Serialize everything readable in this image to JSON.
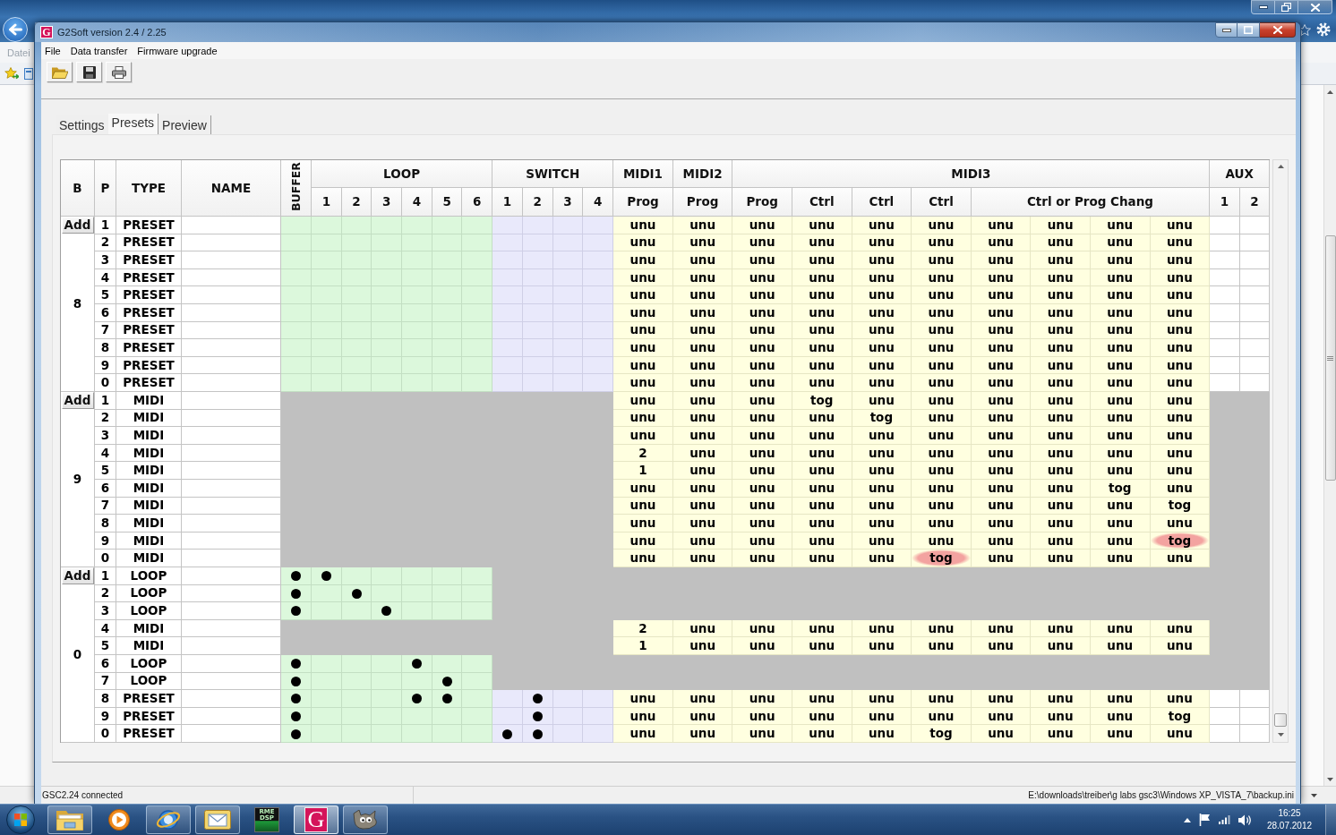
{
  "background_window": {
    "menu": [
      "Datei"
    ]
  },
  "window": {
    "logo": "G",
    "title": "G2Soft version 2.4 / 2.25"
  },
  "menu": [
    "File",
    "Data transfer",
    "Firmware upgrade"
  ],
  "tabs": [
    {
      "label": "Settings",
      "selected": false
    },
    {
      "label": "Presets",
      "selected": true
    },
    {
      "label": "Preview",
      "selected": false
    }
  ],
  "table": {
    "columns": [
      {
        "kind": "single",
        "label": "B"
      },
      {
        "kind": "single",
        "label": "P"
      },
      {
        "kind": "single",
        "label": "TYPE"
      },
      {
        "kind": "single",
        "label": "NAME"
      },
      {
        "kind": "vertical",
        "label": "BUFFER"
      },
      {
        "kind": "group",
        "label": "LOOP",
        "subs": [
          {
            "kind": "single",
            "label": "1"
          },
          {
            "kind": "single",
            "label": "2"
          },
          {
            "kind": "single",
            "label": "3"
          },
          {
            "kind": "single",
            "label": "4"
          },
          {
            "kind": "single",
            "label": "5"
          },
          {
            "kind": "single",
            "label": "6"
          }
        ]
      },
      {
        "kind": "group",
        "label": "SWITCH",
        "subs": [
          {
            "kind": "single",
            "label": "1"
          },
          {
            "kind": "single",
            "label": "2"
          },
          {
            "kind": "single",
            "label": "3"
          },
          {
            "kind": "single",
            "label": "4"
          }
        ]
      },
      {
        "kind": "group",
        "label": "MIDI1",
        "subs": [
          {
            "kind": "single",
            "label": "Prog"
          }
        ]
      },
      {
        "kind": "group",
        "label": "MIDI2",
        "subs": [
          {
            "kind": "single",
            "label": "Prog"
          }
        ]
      },
      {
        "kind": "group",
        "label": "MIDI3",
        "subs": [
          {
            "kind": "single",
            "label": "Prog"
          },
          {
            "kind": "single",
            "label": "Ctrl"
          },
          {
            "kind": "single",
            "label": "Ctrl"
          },
          {
            "kind": "single",
            "label": "Ctrl"
          },
          {
            "kind": "wide",
            "label": "Ctrl or Prog Chang"
          }
        ]
      },
      {
        "kind": "group",
        "label": "AUX",
        "subs": [
          {
            "kind": "single",
            "label": "1"
          },
          {
            "kind": "single",
            "label": "2"
          }
        ]
      }
    ],
    "banks": [
      {
        "add_button": "Add",
        "label": "8",
        "rows": [
          {
            "kind": "preset",
            "p": "1",
            "type": "PRESET",
            "buffer": false,
            "loops": [
              false,
              false,
              false,
              false,
              false,
              false
            ],
            "switches": [
              false,
              false,
              false,
              false
            ],
            "midi": [
              "unu",
              "unu",
              "unu",
              "unu",
              "unu",
              "unu",
              "unu",
              "unu",
              "unu",
              "unu"
            ],
            "circled": [
              false,
              false,
              false,
              false,
              false,
              false,
              false,
              false,
              false,
              false
            ]
          },
          {
            "kind": "preset",
            "p": "2",
            "type": "PRESET",
            "buffer": false,
            "loops": [
              false,
              false,
              false,
              false,
              false,
              false
            ],
            "switches": [
              false,
              false,
              false,
              false
            ],
            "midi": [
              "unu",
              "unu",
              "unu",
              "unu",
              "unu",
              "unu",
              "unu",
              "unu",
              "unu",
              "unu"
            ],
            "circled": [
              false,
              false,
              false,
              false,
              false,
              false,
              false,
              false,
              false,
              false
            ]
          },
          {
            "kind": "preset",
            "p": "3",
            "type": "PRESET",
            "buffer": false,
            "loops": [
              false,
              false,
              false,
              false,
              false,
              false
            ],
            "switches": [
              false,
              false,
              false,
              false
            ],
            "midi": [
              "unu",
              "unu",
              "unu",
              "unu",
              "unu",
              "unu",
              "unu",
              "unu",
              "unu",
              "unu"
            ],
            "circled": [
              false,
              false,
              false,
              false,
              false,
              false,
              false,
              false,
              false,
              false
            ]
          },
          {
            "kind": "preset",
            "p": "4",
            "type": "PRESET",
            "buffer": false,
            "loops": [
              false,
              false,
              false,
              false,
              false,
              false
            ],
            "switches": [
              false,
              false,
              false,
              false
            ],
            "midi": [
              "unu",
              "unu",
              "unu",
              "unu",
              "unu",
              "unu",
              "unu",
              "unu",
              "unu",
              "unu"
            ],
            "circled": [
              false,
              false,
              false,
              false,
              false,
              false,
              false,
              false,
              false,
              false
            ]
          },
          {
            "kind": "preset",
            "p": "5",
            "type": "PRESET",
            "buffer": false,
            "loops": [
              false,
              false,
              false,
              false,
              false,
              false
            ],
            "switches": [
              false,
              false,
              false,
              false
            ],
            "midi": [
              "unu",
              "unu",
              "unu",
              "unu",
              "unu",
              "unu",
              "unu",
              "unu",
              "unu",
              "unu"
            ],
            "circled": [
              false,
              false,
              false,
              false,
              false,
              false,
              false,
              false,
              false,
              false
            ]
          },
          {
            "kind": "preset",
            "p": "6",
            "type": "PRESET",
            "buffer": false,
            "loops": [
              false,
              false,
              false,
              false,
              false,
              false
            ],
            "switches": [
              false,
              false,
              false,
              false
            ],
            "midi": [
              "unu",
              "unu",
              "unu",
              "unu",
              "unu",
              "unu",
              "unu",
              "unu",
              "unu",
              "unu"
            ],
            "circled": [
              false,
              false,
              false,
              false,
              false,
              false,
              false,
              false,
              false,
              false
            ]
          },
          {
            "kind": "preset",
            "p": "7",
            "type": "PRESET",
            "buffer": false,
            "loops": [
              false,
              false,
              false,
              false,
              false,
              false
            ],
            "switches": [
              false,
              false,
              false,
              false
            ],
            "midi": [
              "unu",
              "unu",
              "unu",
              "unu",
              "unu",
              "unu",
              "unu",
              "unu",
              "unu",
              "unu"
            ],
            "circled": [
              false,
              false,
              false,
              false,
              false,
              false,
              false,
              false,
              false,
              false
            ]
          },
          {
            "kind": "preset",
            "p": "8",
            "type": "PRESET",
            "buffer": false,
            "loops": [
              false,
              false,
              false,
              false,
              false,
              false
            ],
            "switches": [
              false,
              false,
              false,
              false
            ],
            "midi": [
              "unu",
              "unu",
              "unu",
              "unu",
              "unu",
              "unu",
              "unu",
              "unu",
              "unu",
              "unu"
            ],
            "circled": [
              false,
              false,
              false,
              false,
              false,
              false,
              false,
              false,
              false,
              false
            ]
          },
          {
            "kind": "preset",
            "p": "9",
            "type": "PRESET",
            "buffer": false,
            "loops": [
              false,
              false,
              false,
              false,
              false,
              false
            ],
            "switches": [
              false,
              false,
              false,
              false
            ],
            "midi": [
              "unu",
              "unu",
              "unu",
              "unu",
              "unu",
              "unu",
              "unu",
              "unu",
              "unu",
              "unu"
            ],
            "circled": [
              false,
              false,
              false,
              false,
              false,
              false,
              false,
              false,
              false,
              false
            ]
          },
          {
            "kind": "preset",
            "p": "0",
            "type": "PRESET",
            "buffer": false,
            "loops": [
              false,
              false,
              false,
              false,
              false,
              false
            ],
            "switches": [
              false,
              false,
              false,
              false
            ],
            "midi": [
              "unu",
              "unu",
              "unu",
              "unu",
              "unu",
              "unu",
              "unu",
              "unu",
              "unu",
              "unu"
            ],
            "circled": [
              false,
              false,
              false,
              false,
              false,
              false,
              false,
              false,
              false,
              false
            ]
          }
        ]
      },
      {
        "add_button": "Add",
        "label": "9",
        "rows": [
          {
            "kind": "midi",
            "p": "1",
            "type": "MIDI",
            "midi": [
              "unu",
              "unu",
              "unu",
              "tog",
              "unu",
              "unu",
              "unu",
              "unu",
              "unu",
              "unu"
            ],
            "circled": [
              false,
              false,
              false,
              false,
              false,
              false,
              false,
              false,
              false,
              false
            ]
          },
          {
            "kind": "midi",
            "p": "2",
            "type": "MIDI",
            "midi": [
              "unu",
              "unu",
              "unu",
              "unu",
              "tog",
              "unu",
              "unu",
              "unu",
              "unu",
              "unu"
            ],
            "circled": [
              false,
              false,
              false,
              false,
              false,
              false,
              false,
              false,
              false,
              false
            ]
          },
          {
            "kind": "midi",
            "p": "3",
            "type": "MIDI",
            "midi": [
              "unu",
              "unu",
              "unu",
              "unu",
              "unu",
              "unu",
              "unu",
              "unu",
              "unu",
              "unu"
            ],
            "circled": [
              false,
              false,
              false,
              false,
              false,
              false,
              false,
              false,
              false,
              false
            ]
          },
          {
            "kind": "midi",
            "p": "4",
            "type": "MIDI",
            "midi": [
              "2",
              "unu",
              "unu",
              "unu",
              "unu",
              "unu",
              "unu",
              "unu",
              "unu",
              "unu"
            ],
            "circled": [
              false,
              false,
              false,
              false,
              false,
              false,
              false,
              false,
              false,
              false
            ]
          },
          {
            "kind": "midi",
            "p": "5",
            "type": "MIDI",
            "midi": [
              "1",
              "unu",
              "unu",
              "unu",
              "unu",
              "unu",
              "unu",
              "unu",
              "unu",
              "unu"
            ],
            "circled": [
              false,
              false,
              false,
              false,
              false,
              false,
              false,
              false,
              false,
              false
            ]
          },
          {
            "kind": "midi",
            "p": "6",
            "type": "MIDI",
            "midi": [
              "unu",
              "unu",
              "unu",
              "unu",
              "unu",
              "unu",
              "unu",
              "unu",
              "tog",
              "unu"
            ],
            "circled": [
              false,
              false,
              false,
              false,
              false,
              false,
              false,
              false,
              false,
              false
            ]
          },
          {
            "kind": "midi",
            "p": "7",
            "type": "MIDI",
            "midi": [
              "unu",
              "unu",
              "unu",
              "unu",
              "unu",
              "unu",
              "unu",
              "unu",
              "unu",
              "tog"
            ],
            "circled": [
              false,
              false,
              false,
              false,
              false,
              false,
              false,
              false,
              false,
              false
            ]
          },
          {
            "kind": "midi",
            "p": "8",
            "type": "MIDI",
            "midi": [
              "unu",
              "unu",
              "unu",
              "unu",
              "unu",
              "unu",
              "unu",
              "unu",
              "unu",
              "unu"
            ],
            "circled": [
              false,
              false,
              false,
              false,
              false,
              false,
              false,
              false,
              false,
              false
            ]
          },
          {
            "kind": "midi",
            "p": "9",
            "type": "MIDI",
            "midi": [
              "unu",
              "unu",
              "unu",
              "unu",
              "unu",
              "unu",
              "unu",
              "unu",
              "unu",
              "tog"
            ],
            "circled": [
              false,
              false,
              false,
              false,
              false,
              false,
              false,
              false,
              false,
              true
            ]
          },
          {
            "kind": "midi",
            "p": "0",
            "type": "MIDI",
            "midi": [
              "unu",
              "unu",
              "unu",
              "unu",
              "unu",
              "tog",
              "unu",
              "unu",
              "unu",
              "unu"
            ],
            "circled": [
              false,
              false,
              false,
              false,
              false,
              true,
              false,
              false,
              false,
              false
            ]
          }
        ]
      },
      {
        "add_button": "Add",
        "label": "0",
        "rows": [
          {
            "kind": "loop",
            "p": "1",
            "type": "LOOP",
            "buffer": true,
            "loops": [
              true,
              false,
              false,
              false,
              false,
              false
            ]
          },
          {
            "kind": "loop",
            "p": "2",
            "type": "LOOP",
            "buffer": true,
            "loops": [
              false,
              true,
              false,
              false,
              false,
              false
            ]
          },
          {
            "kind": "loop",
            "p": "3",
            "type": "LOOP",
            "buffer": true,
            "loops": [
              false,
              false,
              true,
              false,
              false,
              false
            ]
          },
          {
            "kind": "midi",
            "p": "4",
            "type": "MIDI",
            "midi": [
              "2",
              "unu",
              "unu",
              "unu",
              "unu",
              "unu",
              "unu",
              "unu",
              "unu",
              "unu"
            ],
            "circled": [
              false,
              false,
              false,
              false,
              false,
              false,
              false,
              false,
              false,
              false
            ]
          },
          {
            "kind": "midi",
            "p": "5",
            "type": "MIDI",
            "midi": [
              "1",
              "unu",
              "unu",
              "unu",
              "unu",
              "unu",
              "unu",
              "unu",
              "unu",
              "unu"
            ],
            "circled": [
              false,
              false,
              false,
              false,
              false,
              false,
              false,
              false,
              false,
              false
            ]
          },
          {
            "kind": "loop",
            "p": "6",
            "type": "LOOP",
            "buffer": true,
            "loops": [
              false,
              false,
              false,
              true,
              false,
              false
            ]
          },
          {
            "kind": "loop",
            "p": "7",
            "type": "LOOP",
            "buffer": true,
            "loops": [
              false,
              false,
              false,
              false,
              true,
              false
            ]
          },
          {
            "kind": "preset",
            "p": "8",
            "type": "PRESET",
            "buffer": true,
            "loops": [
              false,
              false,
              false,
              true,
              true,
              false
            ],
            "switches": [
              false,
              true,
              false,
              false
            ],
            "midi": [
              "unu",
              "unu",
              "unu",
              "unu",
              "unu",
              "unu",
              "unu",
              "unu",
              "unu",
              "unu"
            ],
            "circled": [
              false,
              false,
              false,
              false,
              false,
              false,
              false,
              false,
              false,
              false
            ]
          },
          {
            "kind": "preset",
            "p": "9",
            "type": "PRESET",
            "buffer": true,
            "loops": [
              false,
              false,
              false,
              false,
              false,
              false
            ],
            "switches": [
              false,
              true,
              false,
              false
            ],
            "midi": [
              "unu",
              "unu",
              "unu",
              "unu",
              "unu",
              "unu",
              "unu",
              "unu",
              "unu",
              "tog"
            ],
            "circled": [
              false,
              false,
              false,
              false,
              false,
              false,
              false,
              false,
              false,
              false
            ]
          },
          {
            "kind": "preset",
            "p": "0",
            "type": "PRESET",
            "buffer": true,
            "loops": [
              false,
              false,
              false,
              false,
              false,
              false
            ],
            "switches": [
              true,
              true,
              false,
              false
            ],
            "midi": [
              "unu",
              "unu",
              "unu",
              "unu",
              "unu",
              "tog",
              "unu",
              "unu",
              "unu",
              "unu"
            ],
            "circled": [
              false,
              false,
              false,
              false,
              false,
              false,
              false,
              false,
              false,
              false
            ]
          }
        ]
      }
    ]
  },
  "status_bar": {
    "status": "GSC2.24 connected",
    "file_path": "E:\\downloads\\treiber\\g labs gsc3\\Windows XP_VISTA_7\\backup.ini"
  },
  "taskbar": {
    "apps": [
      {
        "kind": "explorer",
        "running": true,
        "selected": false
      },
      {
        "kind": "player",
        "running": false,
        "selected": false
      },
      {
        "kind": "browser",
        "running": true,
        "selected": false
      },
      {
        "kind": "mail",
        "running": true,
        "selected": false
      },
      {
        "kind": "dsp",
        "logo": "RME DSP",
        "running": false,
        "selected": false
      },
      {
        "kind": "g2soft",
        "logo": "G",
        "running": true,
        "selected": true
      },
      {
        "kind": "gimp",
        "running": true,
        "selected": false
      }
    ],
    "clock": {
      "time": "16:25",
      "date": "28.07.2012"
    }
  }
}
